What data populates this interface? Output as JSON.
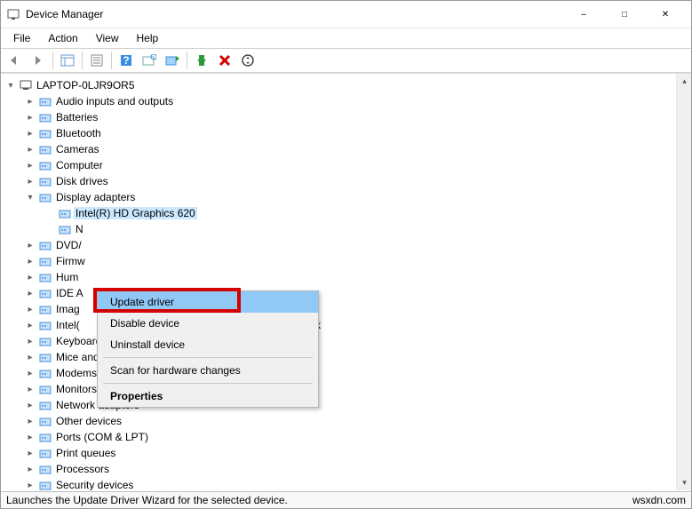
{
  "window": {
    "title": "Device Manager"
  },
  "menu": {
    "file": "File",
    "action": "Action",
    "view": "View",
    "help": "Help"
  },
  "tree": {
    "root": "LAPTOP-0LJR9OR5",
    "items": [
      {
        "label": "Audio inputs and outputs",
        "expanded": false,
        "indent": 1
      },
      {
        "label": "Batteries",
        "expanded": false,
        "indent": 1
      },
      {
        "label": "Bluetooth",
        "expanded": false,
        "indent": 1
      },
      {
        "label": "Cameras",
        "expanded": false,
        "indent": 1
      },
      {
        "label": "Computer",
        "expanded": false,
        "indent": 1
      },
      {
        "label": "Disk drives",
        "expanded": false,
        "indent": 1
      },
      {
        "label": "Display adapters",
        "expanded": true,
        "indent": 1
      },
      {
        "label": "Intel(R) HD Graphics 620",
        "expanded": "none",
        "indent": 2,
        "selected": true
      },
      {
        "label": "N",
        "expanded": "none",
        "indent": 2
      },
      {
        "label": "DVD/",
        "expanded": false,
        "indent": 1
      },
      {
        "label": "Firmw",
        "expanded": false,
        "indent": 1
      },
      {
        "label": "Hum",
        "expanded": false,
        "indent": 1
      },
      {
        "label": "IDE A",
        "expanded": false,
        "indent": 1
      },
      {
        "label": "Imag",
        "expanded": false,
        "indent": 1
      },
      {
        "label": "Intel(",
        "expanded": false,
        "indent": 1,
        "suffix": "rk"
      },
      {
        "label": "Keyboards",
        "expanded": false,
        "indent": 1
      },
      {
        "label": "Mice and other pointing devices",
        "expanded": false,
        "indent": 1
      },
      {
        "label": "Modems",
        "expanded": false,
        "indent": 1
      },
      {
        "label": "Monitors",
        "expanded": false,
        "indent": 1
      },
      {
        "label": "Network adapters",
        "expanded": false,
        "indent": 1
      },
      {
        "label": "Other devices",
        "expanded": false,
        "indent": 1
      },
      {
        "label": "Ports (COM & LPT)",
        "expanded": false,
        "indent": 1
      },
      {
        "label": "Print queues",
        "expanded": false,
        "indent": 1
      },
      {
        "label": "Processors",
        "expanded": false,
        "indent": 1
      },
      {
        "label": "Security devices",
        "expanded": false,
        "indent": 1
      }
    ]
  },
  "context_menu": {
    "update": "Update driver",
    "disable": "Disable device",
    "uninstall": "Uninstall device",
    "scan": "Scan for hardware changes",
    "properties": "Properties"
  },
  "status": {
    "left": "Launches the Update Driver Wizard for the selected device.",
    "right": "wsxdn.com"
  }
}
